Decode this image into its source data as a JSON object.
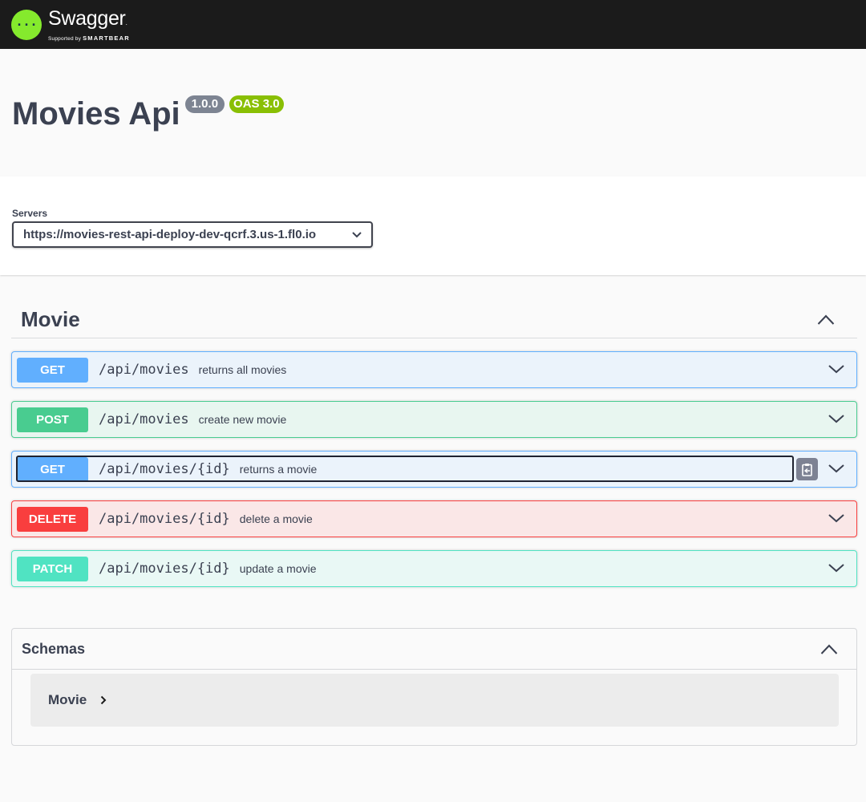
{
  "topbar": {
    "logo_title": "Swagger",
    "logo_sub_prefix": "Supported by",
    "logo_sub_brand": "SMARTBEAR",
    "logo_icon": "swagger-logo-icon"
  },
  "info": {
    "title": "Movies Api",
    "version": "1.0.0",
    "oas": "OAS 3.0"
  },
  "servers": {
    "label": "Servers",
    "selected": "https://movies-rest-api-deploy-dev-qcrf.3.us-1.fl0.io"
  },
  "tag": {
    "name": "Movie",
    "expanded": true
  },
  "operations": [
    {
      "method": "GET",
      "path": "/api/movies",
      "summary": "returns all movies"
    },
    {
      "method": "POST",
      "path": "/api/movies",
      "summary": "create new movie"
    },
    {
      "method": "GET",
      "path": "/api/movies/{id}",
      "summary": "returns a movie"
    },
    {
      "method": "DELETE",
      "path": "/api/movies/{id}",
      "summary": "delete a movie"
    },
    {
      "method": "PATCH",
      "path": "/api/movies/{id}",
      "summary": "update a movie"
    }
  ],
  "schemas": {
    "title": "Schemas",
    "models": [
      {
        "name": "Movie"
      }
    ]
  },
  "colors": {
    "get": "#61affe",
    "post": "#49cc90",
    "delete": "#f93e3e",
    "patch": "#50e3c2",
    "brand": "#85ea2d"
  }
}
